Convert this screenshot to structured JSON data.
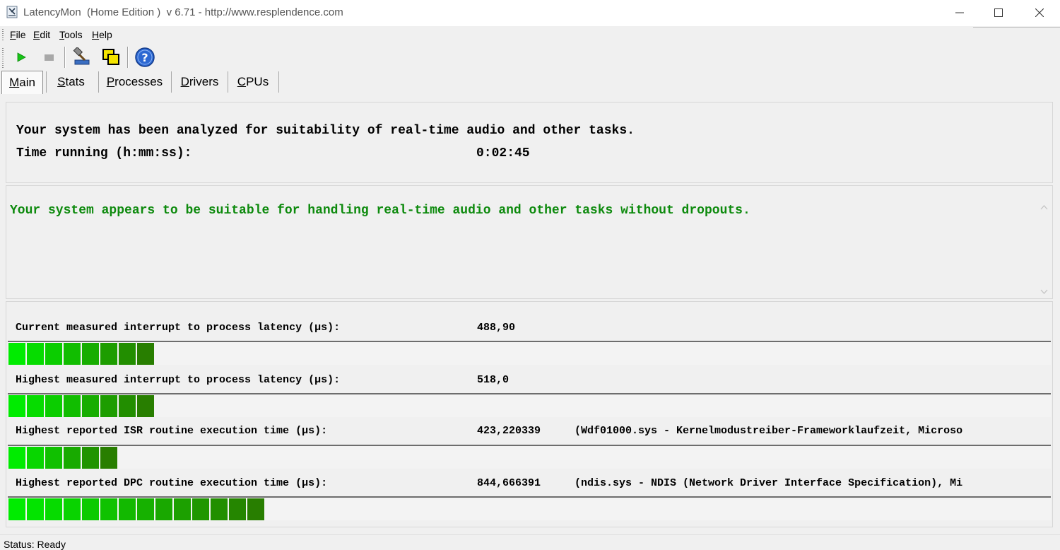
{
  "window": {
    "title": "LatencyMon  (Home Edition )  v 6.71 - http://www.resplendence.com"
  },
  "menu": {
    "items": [
      {
        "label": "File"
      },
      {
        "label": "Edit"
      },
      {
        "label": "Tools"
      },
      {
        "label": "Help"
      }
    ]
  },
  "toolbar": {
    "buttons": [
      {
        "icon": "play-icon"
      },
      {
        "icon": "stop-icon"
      },
      {
        "icon": "hammer-icon"
      },
      {
        "icon": "windows-icon"
      },
      {
        "icon": "help-icon"
      }
    ]
  },
  "tabs": [
    {
      "label": "Main",
      "active": true
    },
    {
      "label": "Stats",
      "active": false
    },
    {
      "label": "Processes",
      "active": false
    },
    {
      "label": "Drivers",
      "active": false
    },
    {
      "label": "CPUs",
      "active": false
    }
  ],
  "summary": {
    "line1": "Your system has been analyzed for suitability of real-time audio and other tasks.",
    "time_label": "Time running (h:mm:ss):",
    "time_value": "0:02:45"
  },
  "verdict": {
    "text": "Your system appears to be suitable for handling real-time audio and other tasks without dropouts.",
    "color": "#0d8a0d"
  },
  "metrics": [
    {
      "label": "Current measured interrupt to process latency (µs):",
      "value": "488,90",
      "detail": "",
      "segments": 8
    },
    {
      "label": "Highest measured interrupt to process latency (µs):",
      "value": "518,0",
      "detail": "",
      "segments": 8
    },
    {
      "label": "Highest reported ISR routine execution time (µs):",
      "value": "423,220339",
      "detail": "(Wdf01000.sys - Kernelmodustreiber-Frameworklaufzeit, Microso",
      "segments": 6
    },
    {
      "label": "Highest reported DPC routine execution time (µs):",
      "value": "844,666391",
      "detail": "(ndis.sys - NDIS (Network Driver Interface Specification), Mi",
      "segments": 14
    }
  ],
  "status": {
    "text": "Status: Ready"
  }
}
